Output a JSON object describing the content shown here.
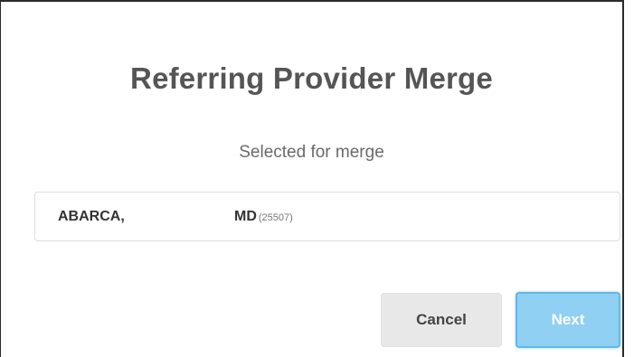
{
  "dialog": {
    "title": "Referring Provider Merge",
    "subtitle": "Selected for merge"
  },
  "selected_provider": {
    "last_name": "ABARCA,",
    "suffix": "MD",
    "id": "(25507)"
  },
  "buttons": {
    "cancel_label": "Cancel",
    "next_label": "Next"
  },
  "colors": {
    "title_text": "#555555",
    "next_button_bg": "#8fd0f3",
    "next_button_border": "#62b7e8",
    "cancel_button_bg": "#e8e8e8"
  }
}
